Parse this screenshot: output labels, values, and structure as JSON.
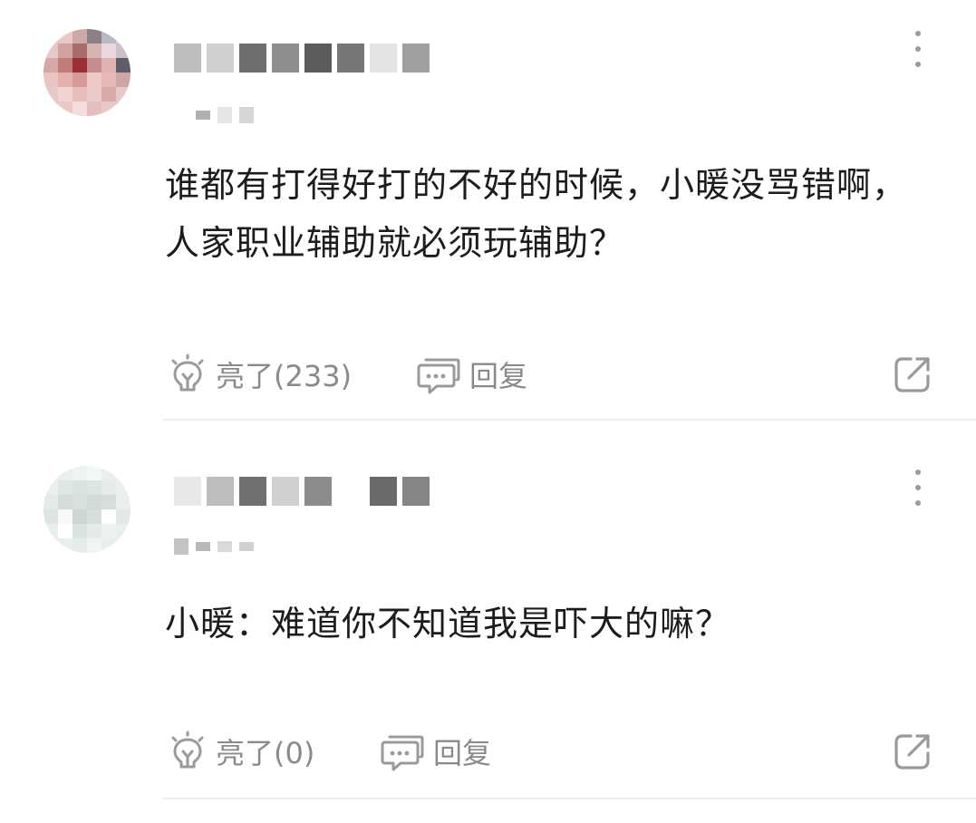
{
  "comments": [
    {
      "body": "谁都有打得好打的不好的时候，小暖没骂错啊，人家职业辅助就必须玩辅助？",
      "like_label": "亮了(233)",
      "reply_label": "回复"
    },
    {
      "body": "小暖：难道你不知道我是吓大的嘛？",
      "like_label": "亮了(0)",
      "reply_label": "回复"
    }
  ],
  "icons": {
    "like": "lightbulb-icon",
    "reply": "chat-bubble-icon",
    "share": "share-icon",
    "more": "more-vertical-icon"
  },
  "colors": {
    "action_text": "#8a8a8a",
    "body_text": "#1c1c1c",
    "divider": "#ededed"
  }
}
